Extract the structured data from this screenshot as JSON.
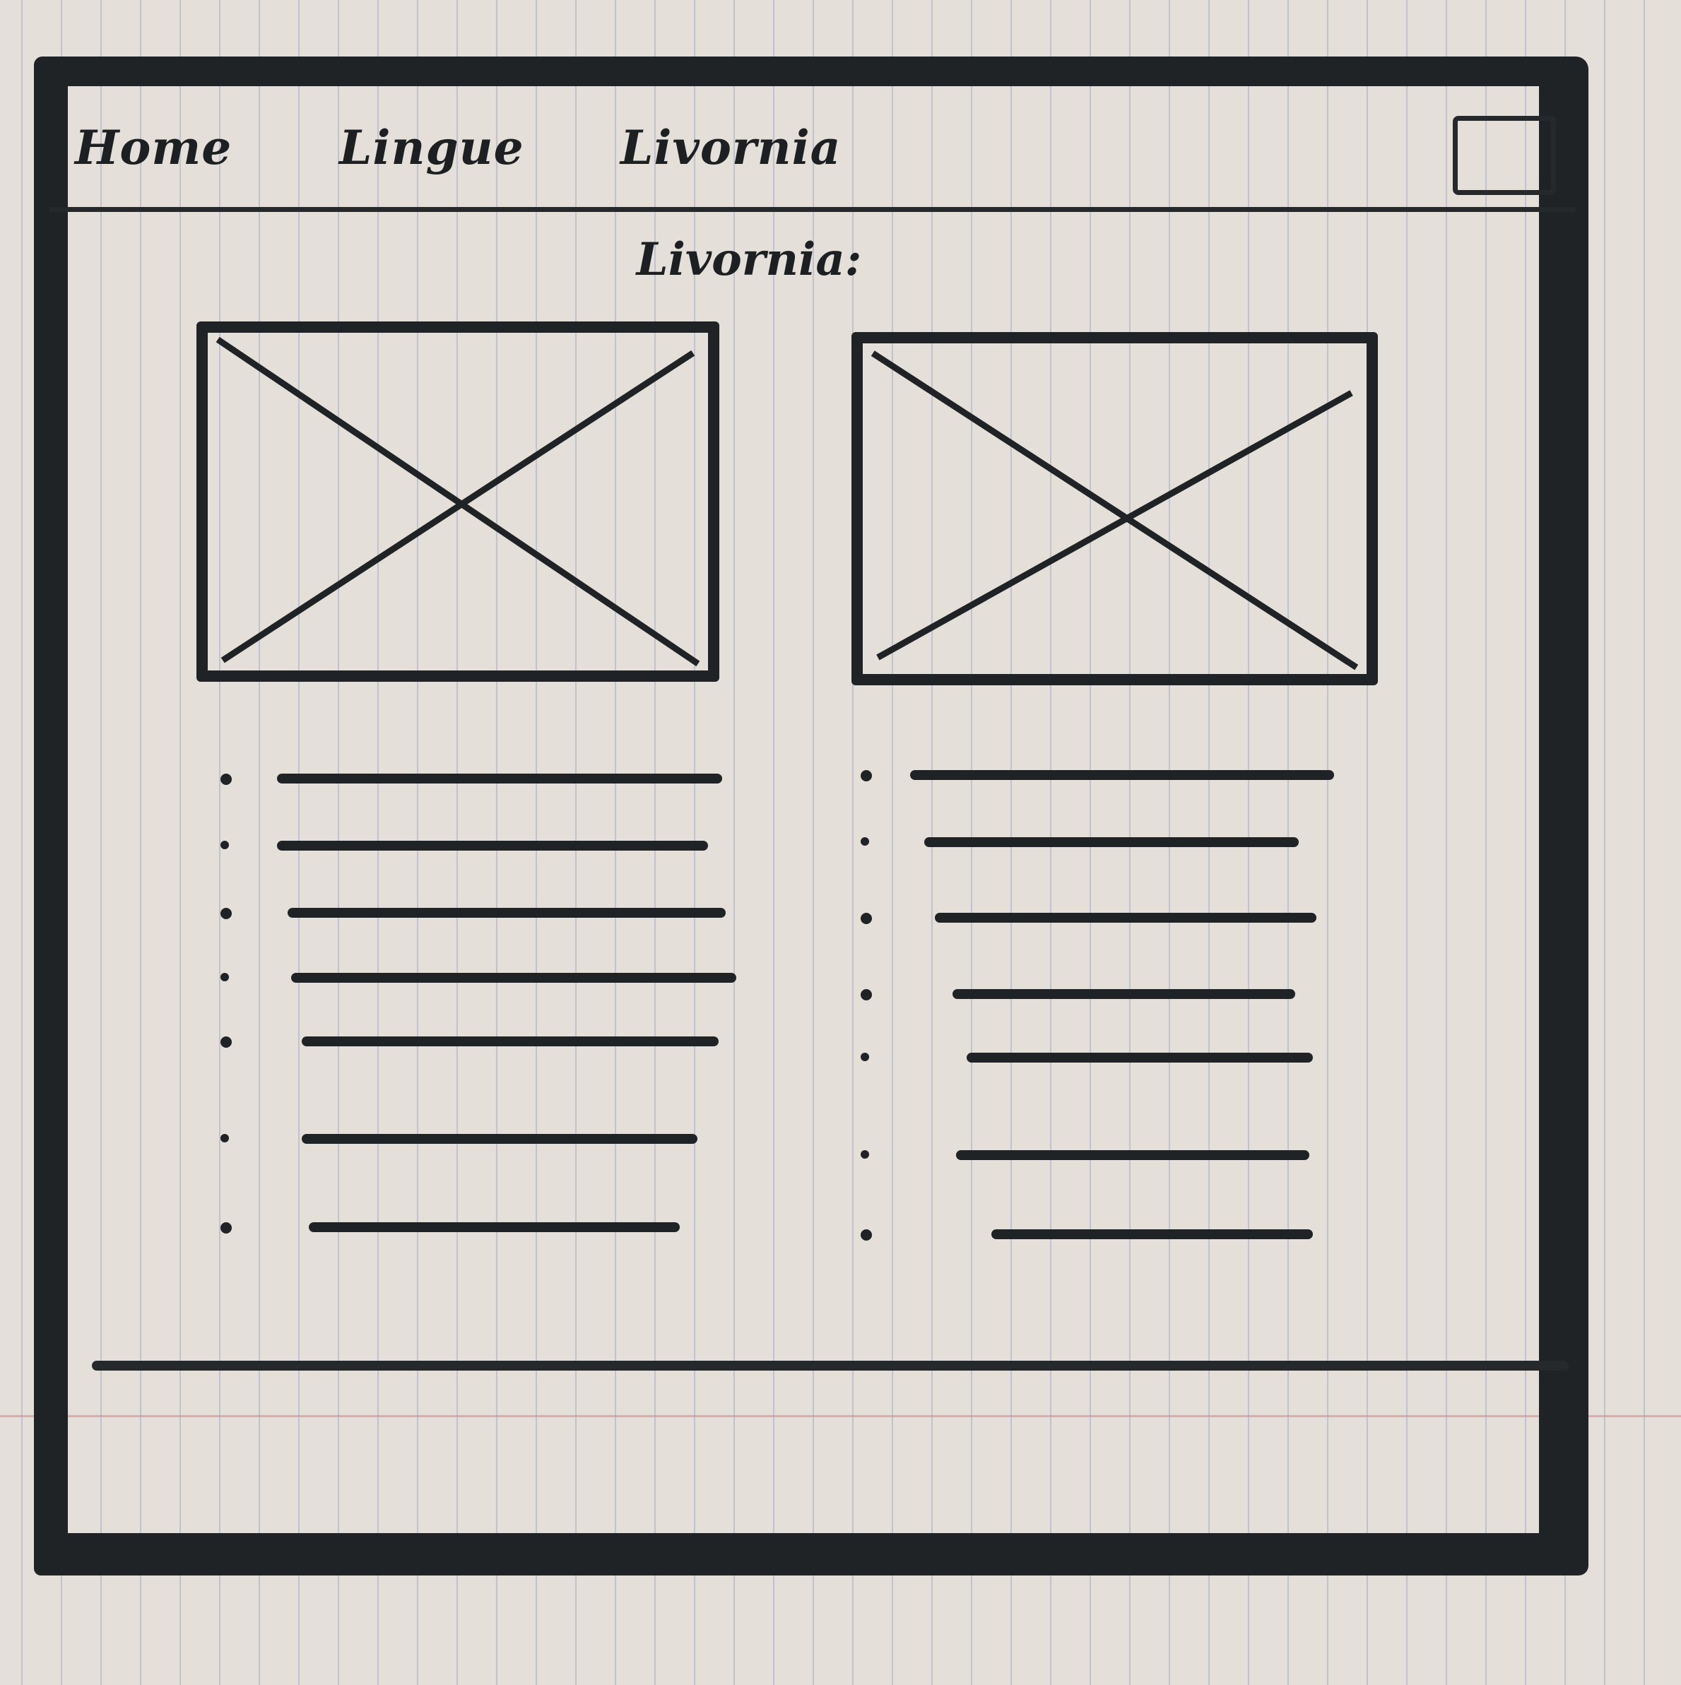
{
  "navbar": {
    "items": [
      {
        "label": "Home"
      },
      {
        "label": "Lingue"
      },
      {
        "label": "Livornia"
      }
    ]
  },
  "main": {
    "title": "Livornia:"
  },
  "cards": [
    {
      "bullet_count": 7
    },
    {
      "bullet_count": 7
    }
  ],
  "colors": {
    "ink": "#202326",
    "paper": "#e4dfd8"
  },
  "icons": {
    "image_placeholder": "image-placeholder-icon",
    "window_button": "square-icon"
  }
}
